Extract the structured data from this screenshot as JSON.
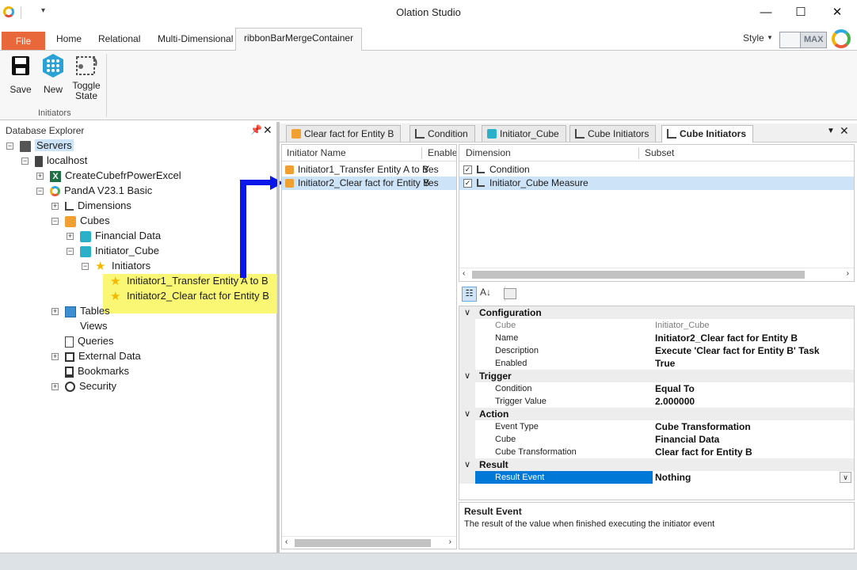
{
  "window": {
    "title": "Olation Studio",
    "minimize": "—",
    "maximize": "☐",
    "close": "✕"
  },
  "ribbon_tabs": {
    "file": "File",
    "home": "Home",
    "relational": "Relational",
    "multi": "Multi-Dimensional",
    "merge": "ribbonBarMergeContainer"
  },
  "style_label": "Style",
  "max_toggle": "MAX",
  "ribbon": {
    "save": "Save",
    "new": "New",
    "toggle1": "Toggle",
    "toggle2": "State",
    "group": "Initiators"
  },
  "explorer": {
    "title": "Database Explorer",
    "items": [
      {
        "label": "Servers",
        "level": 0,
        "exp": "−",
        "icon": "server"
      },
      {
        "label": "localhost",
        "level": 1,
        "exp": "−",
        "icon": "host"
      },
      {
        "label": "CreateCubefrPowerExcel",
        "level": 2,
        "exp": "+",
        "icon": "excel"
      },
      {
        "label": "PandA V23.1 Basic",
        "level": 2,
        "exp": "−",
        "icon": "ring"
      },
      {
        "label": "Dimensions",
        "level": 3,
        "exp": "+",
        "icon": "dimension"
      },
      {
        "label": "Cubes",
        "level": 3,
        "exp": "−",
        "icon": "cube-orange"
      },
      {
        "label": "Financial Data",
        "level": 4,
        "exp": "+",
        "icon": "cube-teal"
      },
      {
        "label": "Initiator_Cube",
        "level": 4,
        "exp": "−",
        "icon": "cube-teal"
      },
      {
        "label": "Initiators",
        "level": 5,
        "exp": "−",
        "icon": "star"
      },
      {
        "label": "Initiator1_Transfer Entity A to B",
        "level": 6,
        "exp": "",
        "icon": "star"
      },
      {
        "label": "Initiator2_Clear fact for Entity B",
        "level": 6,
        "exp": "",
        "icon": "star"
      },
      {
        "label": "Tables",
        "level": 3,
        "exp": "+",
        "icon": "table"
      },
      {
        "label": "Views",
        "level": 3,
        "exp": "",
        "icon": "blank"
      },
      {
        "label": "Queries",
        "level": 3,
        "exp": "",
        "icon": "query"
      },
      {
        "label": "External Data",
        "level": 3,
        "exp": "+",
        "icon": "external"
      },
      {
        "label": "Bookmarks",
        "level": 3,
        "exp": "",
        "icon": "bookmark"
      },
      {
        "label": "Security",
        "level": 3,
        "exp": "+",
        "icon": "lock"
      }
    ]
  },
  "doc_tabs": [
    "Clear fact for Entity B",
    "Condition",
    "Initiator_Cube",
    "Cube Initiators",
    "Cube Initiators"
  ],
  "initiator_grid": {
    "col_name": "Initiator Name",
    "col_enabled": "Enable",
    "rows": [
      {
        "name": "Initiator1_Transfer Entity A to B",
        "enabled": "Yes"
      },
      {
        "name": "Initiator2_Clear fact for Entity B",
        "enabled": "Yes"
      }
    ]
  },
  "dimension_grid": {
    "col_dimension": "Dimension",
    "col_subset": "Subset",
    "rows": [
      {
        "name": "Condition"
      },
      {
        "name": "Initiator_Cube Measure"
      }
    ]
  },
  "properties": {
    "categories": [
      {
        "name": "Configuration",
        "rows": [
          {
            "k": "Cube",
            "v": "Initiator_Cube",
            "ro": true
          },
          {
            "k": "Name",
            "v": "Initiator2_Clear fact for Entity B"
          },
          {
            "k": "Description",
            "v": "Execute 'Clear fact for Entity B' Task"
          },
          {
            "k": "Enabled",
            "v": "True"
          }
        ]
      },
      {
        "name": "Trigger",
        "rows": [
          {
            "k": "Condition",
            "v": "Equal To"
          },
          {
            "k": "Trigger Value",
            "v": "2.000000"
          }
        ]
      },
      {
        "name": "Action",
        "rows": [
          {
            "k": "Event Type",
            "v": "Cube Transformation"
          },
          {
            "k": "Cube",
            "v": "Financial Data"
          },
          {
            "k": "Cube Transformation",
            "v": "Clear fact for Entity B"
          }
        ]
      },
      {
        "name": "Result",
        "rows": [
          {
            "k": "Result Event",
            "v": "Nothing",
            "sel": true
          }
        ]
      }
    ]
  },
  "description": {
    "title": "Result Event",
    "text": "The result of the value when finished executing the initiator event"
  }
}
